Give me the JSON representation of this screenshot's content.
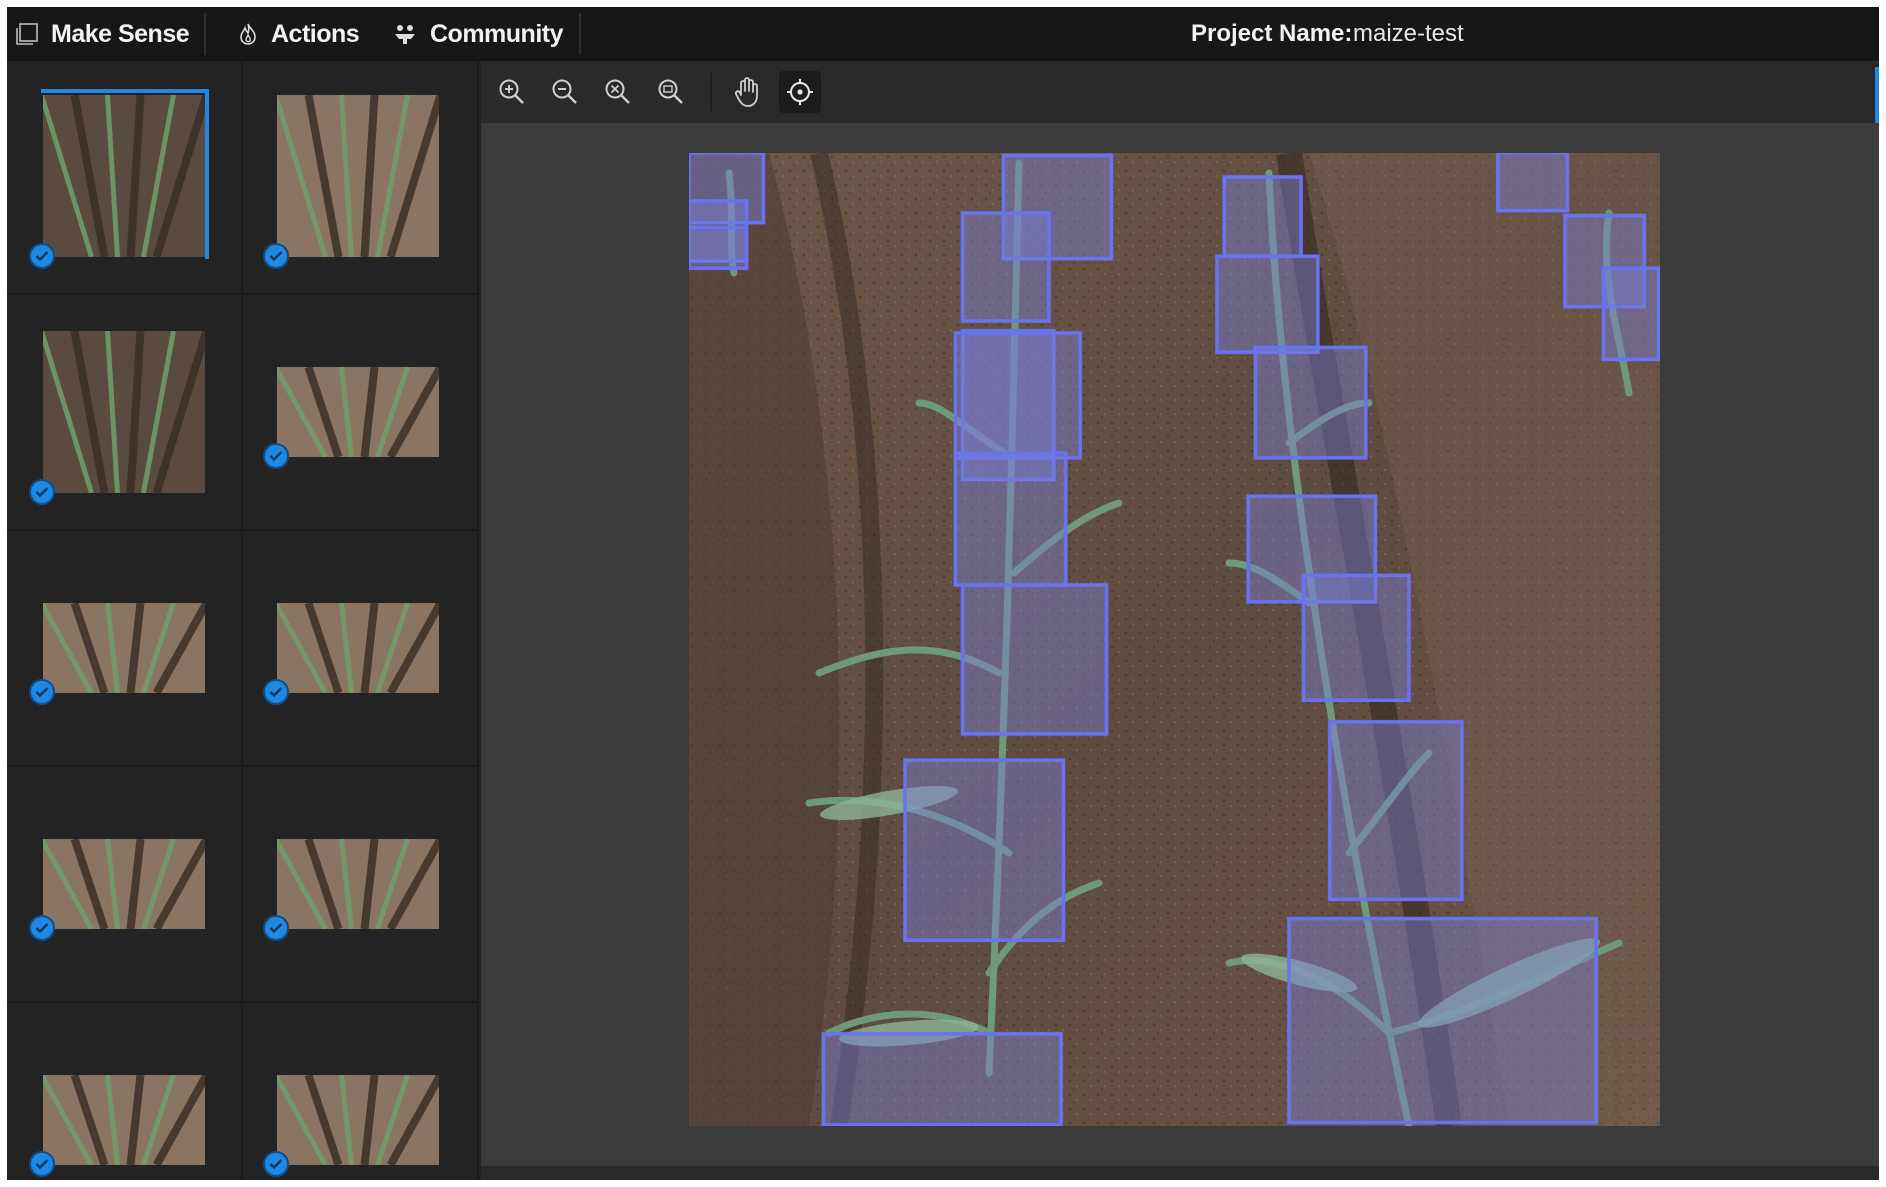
{
  "header": {
    "app_name": "Make Sense",
    "app_icon": "frame-icon",
    "menu": [
      {
        "label": "Actions",
        "icon": "flame-icon"
      },
      {
        "label": "Community",
        "icon": "community-icon"
      }
    ],
    "project_label": "Project Name:",
    "project_name": "maize-test"
  },
  "toolbar": {
    "tools": [
      {
        "name": "zoom-in",
        "icon": "zoom-in-icon"
      },
      {
        "name": "zoom-out",
        "icon": "zoom-out-icon"
      },
      {
        "name": "zoom-fit",
        "icon": "zoom-fit-icon"
      },
      {
        "name": "zoom-max",
        "icon": "zoom-max-icon"
      },
      {
        "name": "pan",
        "icon": "hand-icon"
      },
      {
        "name": "crosshair",
        "icon": "crosshair-icon",
        "active": true
      }
    ]
  },
  "sidebar": {
    "images": [
      {
        "status": "annotated",
        "selected": true
      },
      {
        "status": "annotated"
      },
      {
        "status": "annotated"
      },
      {
        "status": "annotated"
      },
      {
        "status": "annotated"
      },
      {
        "status": "annotated"
      },
      {
        "status": "annotated"
      },
      {
        "status": "annotated"
      },
      {
        "status": "annotated"
      },
      {
        "status": "annotated"
      }
    ]
  },
  "annotations": {
    "label_count": 27
  },
  "colors": {
    "accent": "#1e88e5",
    "box_stroke": "#6b72f0",
    "box_fill": "#7a7fd8",
    "topbar_bg": "#171717",
    "sidebar_bg": "#232323",
    "canvas_bg": "#3c3c3c"
  }
}
